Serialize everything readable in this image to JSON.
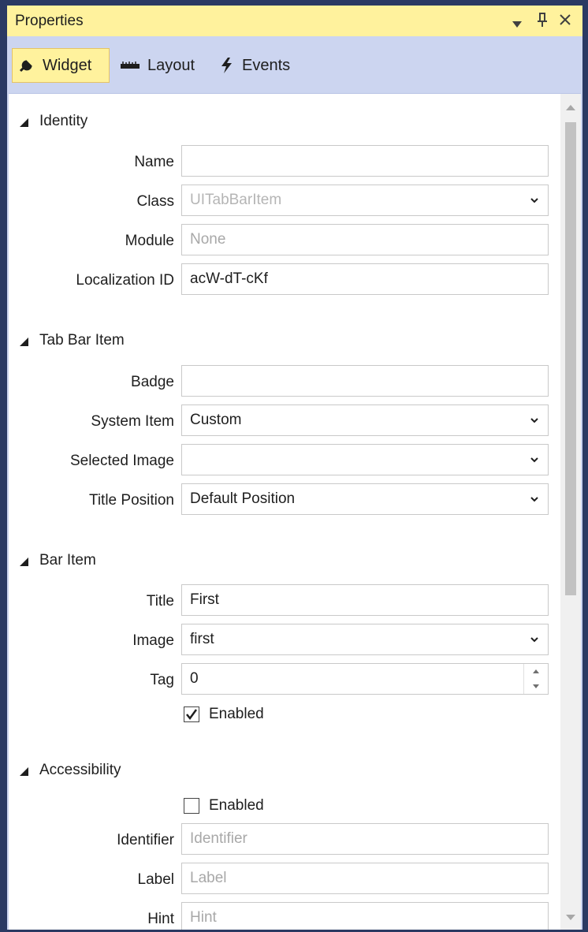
{
  "panel": {
    "title": "Properties"
  },
  "tabs": [
    {
      "label": "Widget",
      "icon": "wrench-icon",
      "active": true
    },
    {
      "label": "Layout",
      "icon": "ruler-icon",
      "active": false
    },
    {
      "label": "Events",
      "icon": "lightning-icon",
      "active": false
    }
  ],
  "identity": {
    "section": "Identity",
    "name_label": "Name",
    "name_value": "",
    "class_label": "Class",
    "class_placeholder": "UITabBarItem",
    "module_label": "Module",
    "module_placeholder": "None",
    "localization_label": "Localization ID",
    "localization_value": "acW-dT-cKf"
  },
  "tab_bar_item": {
    "section": "Tab Bar Item",
    "badge_label": "Badge",
    "badge_value": "",
    "system_item_label": "System Item",
    "system_item_value": "Custom",
    "selected_image_label": "Selected Image",
    "selected_image_value": "",
    "title_position_label": "Title Position",
    "title_position_value": "Default Position"
  },
  "bar_item": {
    "section": "Bar Item",
    "title_label": "Title",
    "title_value": "First",
    "image_label": "Image",
    "image_value": "first",
    "tag_label": "Tag",
    "tag_value": "0",
    "enabled_label": "Enabled",
    "enabled_checked": true
  },
  "accessibility": {
    "section": "Accessibility",
    "enabled_label": "Enabled",
    "enabled_checked": false,
    "identifier_label": "Identifier",
    "identifier_placeholder": "Identifier",
    "label_label": "Label",
    "label_placeholder": "Label",
    "hint_label": "Hint",
    "hint_placeholder": "Hint"
  },
  "colors": {
    "titlebar": "#fff29d",
    "panel_bg": "#ccd5f0",
    "frame": "#2b3a63"
  }
}
